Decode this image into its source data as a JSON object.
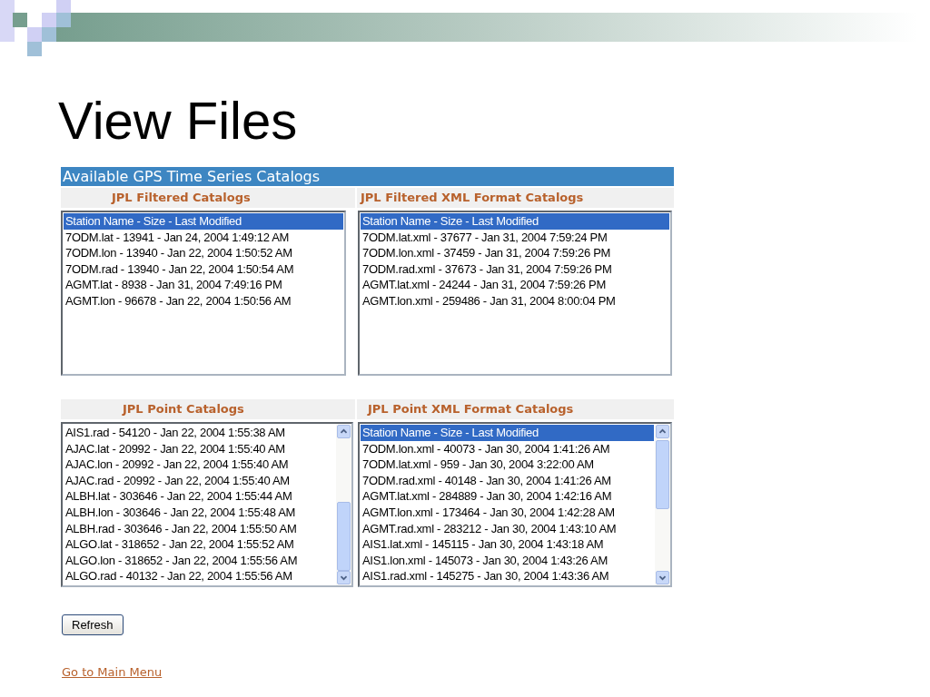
{
  "slide": {
    "title": "View Files"
  },
  "panel": {
    "title": "Available GPS Time Series Catalogs",
    "catalogs": [
      {
        "heading": "JPL Filtered Catalogs",
        "scrollable": false,
        "items": [
          {
            "text": "Station Name - Size - Last Modified",
            "selected": true
          },
          {
            "text": "7ODM.lat - 13941 - Jan 24, 2004 1:49:12 AM",
            "selected": false
          },
          {
            "text": "7ODM.lon - 13940 - Jan 22, 2004 1:50:52 AM",
            "selected": false
          },
          {
            "text": "7ODM.rad - 13940 - Jan 22, 2004 1:50:54 AM",
            "selected": false
          },
          {
            "text": "AGMT.lat - 8938 - Jan 31, 2004 7:49:16 PM",
            "selected": false
          },
          {
            "text": "AGMT.lon - 96678 - Jan 22, 2004 1:50:56 AM",
            "selected": false
          }
        ]
      },
      {
        "heading": "JPL Filtered XML Format Catalogs",
        "scrollable": false,
        "items": [
          {
            "text": "Station Name - Size - Last Modified",
            "selected": true
          },
          {
            "text": "7ODM.lat.xml - 37677 - Jan 31, 2004 7:59:24 PM",
            "selected": false
          },
          {
            "text": "7ODM.lon.xml - 37459 - Jan 31, 2004 7:59:26 PM",
            "selected": false
          },
          {
            "text": "7ODM.rad.xml - 37673 - Jan 31, 2004 7:59:26 PM",
            "selected": false
          },
          {
            "text": "AGMT.lat.xml - 24244 - Jan 31, 2004 7:59:26 PM",
            "selected": false
          },
          {
            "text": "AGMT.lon.xml - 259486 - Jan 31, 2004 8:00:04 PM",
            "selected": false
          }
        ]
      },
      {
        "heading": "JPL Point Catalogs",
        "scrollable": true,
        "items": [
          {
            "text": "AIS1.rad - 54120 - Jan 22, 2004 1:55:38 AM",
            "selected": false
          },
          {
            "text": "AJAC.lat - 20992 - Jan 22, 2004 1:55:40 AM",
            "selected": false
          },
          {
            "text": "AJAC.lon - 20992 - Jan 22, 2004 1:55:40 AM",
            "selected": false
          },
          {
            "text": "AJAC.rad - 20992 - Jan 22, 2004 1:55:40 AM",
            "selected": false
          },
          {
            "text": "ALBH.lat - 303646 - Jan 22, 2004 1:55:44 AM",
            "selected": false
          },
          {
            "text": "ALBH.lon - 303646 - Jan 22, 2004 1:55:48 AM",
            "selected": false
          },
          {
            "text": "ALBH.rad - 303646 - Jan 22, 2004 1:55:50 AM",
            "selected": false
          },
          {
            "text": "ALGO.lat - 318652 - Jan 22, 2004 1:55:52 AM",
            "selected": false
          },
          {
            "text": "ALGO.lon - 318652 - Jan 22, 2004 1:55:56 AM",
            "selected": false
          },
          {
            "text": "ALGO.rad - 40132 - Jan 22, 2004 1:55:56 AM",
            "selected": false
          }
        ]
      },
      {
        "heading": "JPL Point XML Format Catalogs",
        "scrollable": true,
        "items": [
          {
            "text": "Station Name - Size - Last Modified",
            "selected": true
          },
          {
            "text": "7ODM.lon.xml - 40073 - Jan 30, 2004 1:41:26 AM",
            "selected": false
          },
          {
            "text": "7ODM.lat.xml - 959 - Jan 30, 2004 3:22:00 AM",
            "selected": false
          },
          {
            "text": "7ODM.rad.xml - 40148 - Jan 30, 2004 1:41:26 AM",
            "selected": false
          },
          {
            "text": "AGMT.lat.xml - 284889 - Jan 30, 2004 1:42:16 AM",
            "selected": false
          },
          {
            "text": "AGMT.lon.xml - 173464 - Jan 30, 2004 1:42:28 AM",
            "selected": false
          },
          {
            "text": "AGMT.rad.xml - 283212 - Jan 30, 2004 1:43:10 AM",
            "selected": false
          },
          {
            "text": "AIS1.lat.xml - 145115 - Jan 30, 2004 1:43:18 AM",
            "selected": false
          },
          {
            "text": "AIS1.lon.xml - 145073 - Jan 30, 2004 1:43:26 AM",
            "selected": false
          },
          {
            "text": "AIS1.rad.xml - 145275 - Jan 30, 2004 1:43:36 AM",
            "selected": false
          }
        ]
      }
    ]
  },
  "buttons": [
    {
      "label": "Refresh"
    }
  ],
  "link": {
    "label": "Go to Main Menu"
  }
}
